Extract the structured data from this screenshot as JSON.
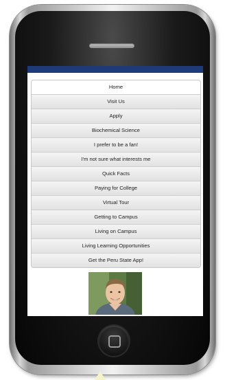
{
  "menu": {
    "items": [
      {
        "label": "Home"
      },
      {
        "label": "Visit Us"
      },
      {
        "label": "Apply"
      },
      {
        "label": "Biochemical Science"
      },
      {
        "label": "I prefer to be a fan!"
      },
      {
        "label": "I'm not sure what interests me"
      },
      {
        "label": "Quick Facts"
      },
      {
        "label": "Paying for College"
      },
      {
        "label": "Virtual Tour"
      },
      {
        "label": "Getting to Campus"
      },
      {
        "label": "Living on Campus"
      },
      {
        "label": "Living Learning Opportunities"
      },
      {
        "label": "Get the Peru State App!"
      }
    ]
  },
  "colors": {
    "top_bar": "#1f3a78",
    "menu_background": "#ebebeb"
  },
  "icons": {
    "home": "home-button-square-icon"
  }
}
